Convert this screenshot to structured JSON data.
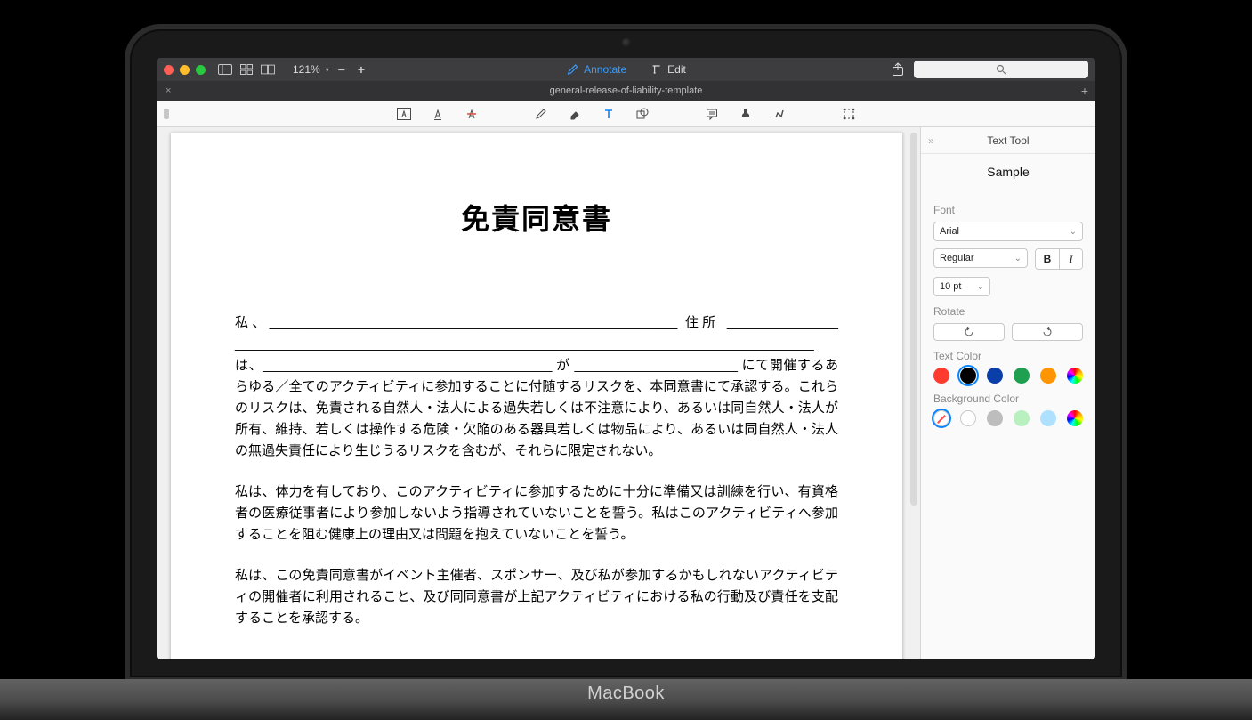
{
  "laptop": {
    "brand": "MacBook"
  },
  "titlebar": {
    "zoom": "121%",
    "tabs": {
      "annotate": "Annotate",
      "edit": "Edit"
    },
    "search_placeholder": ""
  },
  "tabstrip": {
    "document_title": "general-release-of-liability-template"
  },
  "inspector": {
    "title": "Text Tool",
    "sample": "Sample",
    "font_label": "Font",
    "font_family": "Arial",
    "font_style": "Regular",
    "font_size": "10 pt",
    "bold_label": "B",
    "italic_label": "I",
    "rotate_label": "Rotate",
    "text_color_label": "Text Color",
    "bg_color_label": "Background Color",
    "text_colors": [
      "#ff3b30",
      "#000000",
      "#0a3ea8",
      "#1ea050",
      "#ff9500",
      "rainbow"
    ],
    "text_color_selected_index": 1,
    "bg_colors": [
      "none",
      "#ffffff",
      "#bdbdbd",
      "#b8f0c0",
      "#aee0ff",
      "rainbow"
    ],
    "bg_color_selected_index": 0
  },
  "document": {
    "title": "免責同意書",
    "para1": "私、_______________________________________________________ 住所 _______________ ______________________________________________________________________________ は、_______________________________________ が ______________________ にて開催するあらゆる／全てのアクティビティに参加することに付随するリスクを、本同意書にて承認する。これらのリスクは、免責される自然人・法人による過失若しくは不注意により、あるいは同自然人・法人が所有、維持、若しくは操作する危険・欠陥のある器具若しくは物品により、あるいは同自然人・法人の無過失責任により生じうるリスクを含むが、それらに限定されない。",
    "para2": "私は、体力を有しており、このアクティビティに参加するために十分に準備又は訓練を行い、有資格者の医療従事者により参加しないよう指導されていないことを誓う。私はこのアクティビティへ参加することを阻む健康上の理由又は問題を抱えていないことを誓う。",
    "para3": "私は、この免責同意書がイベント主催者、スポンサー、及び私が参加するかもしれないアクティビティの開催者に利用されること、及び同同意書が上記アクティビティにおける私の行動及び責任を支配することを承認する。"
  }
}
